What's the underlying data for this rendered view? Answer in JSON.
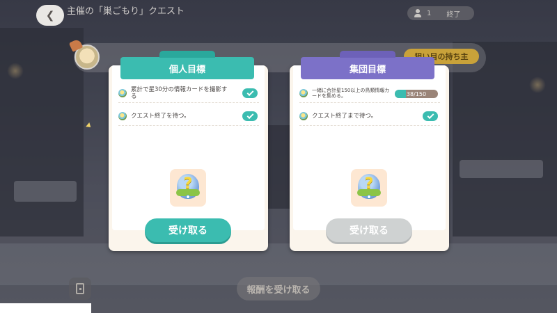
{
  "header": {
    "back_icon": "chevron-left-icon",
    "quest_title": "主催の「巣ごもり」クエスト",
    "participant_count": "1",
    "end_label": "終了"
  },
  "strip": {
    "friend_tag": "狙い目の持ち主"
  },
  "personal": {
    "title": "個人目標",
    "goals": [
      {
        "text": "累計で星30分の情報カードを撮影する",
        "done": true
      },
      {
        "text": "クエスト終了を待つ。",
        "done": true
      }
    ],
    "claim_label": "受け取る"
  },
  "group": {
    "title": "集団目標",
    "goals": [
      {
        "text": "一緒に合計星150以上の鳥類情報カードを集める。",
        "progress_label": "38/150",
        "progress_value": 0.2533
      },
      {
        "text": "クエスト終了まで待つ。",
        "done": true
      }
    ],
    "claim_label": "受け取る"
  },
  "footer": {
    "claim_reward_label": "報酬を受け取る"
  },
  "colors": {
    "personal_accent": "#3bbcb0",
    "group_accent": "#7c71c8",
    "disabled_button": "#cfd2d2"
  }
}
